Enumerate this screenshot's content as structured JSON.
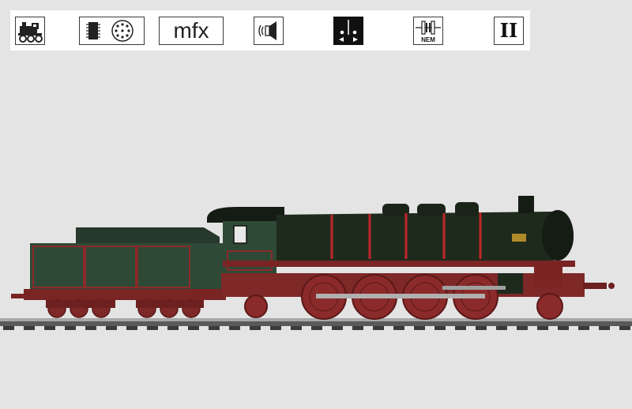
{
  "icon_strip": {
    "icons": [
      {
        "name": "steam-locomotive-icon"
      },
      {
        "name": "decoder-icon"
      },
      {
        "name": "mfx-icon",
        "text": "mfx"
      },
      {
        "name": "sound-icon"
      },
      {
        "name": "headlight-icon"
      },
      {
        "name": "nem-coupler-icon",
        "text": "NEM"
      },
      {
        "name": "gauge-icon",
        "text": "II"
      }
    ]
  },
  "product": {
    "image": "steam-locomotive-with-tender",
    "colors": {
      "boiler": "#1e2a1c",
      "tender": "#2e4a36",
      "frame_red": "#8b2a2a",
      "band_red": "#c0262a",
      "rail": "#9a9a9a"
    }
  }
}
